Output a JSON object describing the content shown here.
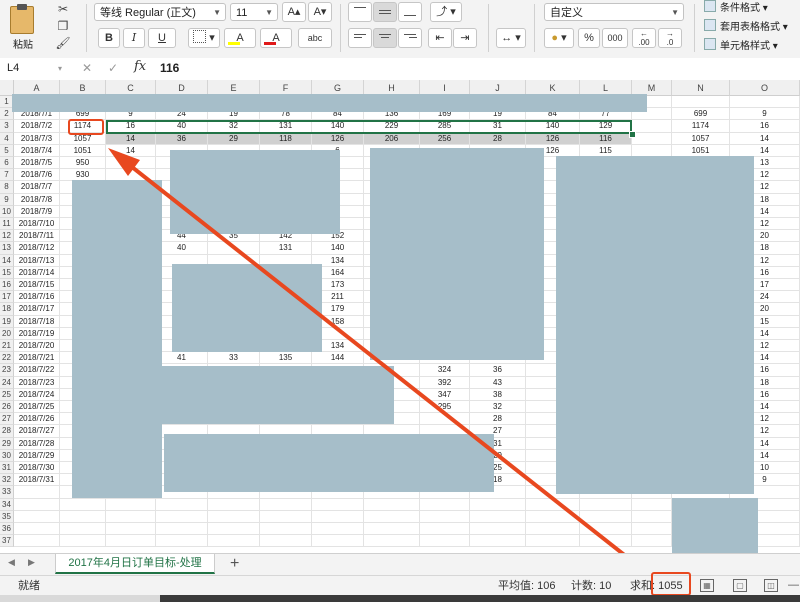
{
  "ribbon": {
    "paste_label": "粘贴",
    "font_name": "等线 Regular (正文)",
    "font_size": "11",
    "grow_font_label": "A▴",
    "shrink_font_label": "A▾",
    "bold_label": "B",
    "italic_label": "I",
    "underline_label": "U",
    "font_color_label": "A",
    "highlight_label": "A",
    "phonetic_label": "abc",
    "number_format": "自定义",
    "percent_label": "%",
    "comma_label": "000",
    "inc_decimal_label": ".00",
    "dec_decimal_label": ".0",
    "conditional_format": "条件格式",
    "format_as_table": "套用表格格式",
    "cell_styles": "单元格样式"
  },
  "formula_bar": {
    "cell_ref": "L4",
    "cancel": "✕",
    "confirm": "✓",
    "fx": "fx",
    "value": "116"
  },
  "columns": [
    "A",
    "B",
    "C",
    "D",
    "E",
    "F",
    "G",
    "H",
    "I",
    "J",
    "K",
    "L",
    "M",
    "N",
    "O"
  ],
  "rows": [
    {
      "n": "1",
      "cells": [
        "",
        "",
        "",
        "",
        "",
        "",
        "",
        "",
        "",
        "",
        "",
        "",
        "",
        "",
        ""
      ]
    },
    {
      "n": "2",
      "cells": [
        "2018/7/1",
        "699",
        "9",
        "24",
        "19",
        "78",
        "84",
        "136",
        "169",
        "19",
        "84",
        "77",
        "",
        "699",
        "9"
      ]
    },
    {
      "n": "3",
      "cells": [
        "2018/7/2",
        "1174",
        "16",
        "40",
        "32",
        "131",
        "140",
        "229",
        "285",
        "31",
        "140",
        "129",
        "",
        "1174",
        "16"
      ]
    },
    {
      "n": "4",
      "cells": [
        "2018/7/3",
        "1057",
        "14",
        "36",
        "29",
        "118",
        "126",
        "206",
        "256",
        "28",
        "126",
        "116",
        "",
        "1057",
        "14"
      ]
    },
    {
      "n": "5",
      "cells": [
        "2018/7/4",
        "1051",
        "14",
        "",
        "",
        "",
        "6",
        "",
        "",
        "",
        "126",
        "115",
        "",
        "1051",
        "14"
      ]
    },
    {
      "n": "6",
      "cells": [
        "2018/7/5",
        "950",
        "",
        "",
        "",
        "",
        "",
        "",
        "",
        "",
        "",
        "",
        "",
        "",
        "13"
      ]
    },
    {
      "n": "7",
      "cells": [
        "2018/7/6",
        "930",
        "",
        "",
        "",
        "",
        "1",
        "",
        "",
        "",
        "",
        "",
        "",
        "",
        "12"
      ]
    },
    {
      "n": "8",
      "cells": [
        "2018/7/7",
        "",
        "",
        "",
        "",
        "",
        "1",
        "",
        "",
        "",
        "",
        "",
        "",
        "",
        "12"
      ]
    },
    {
      "n": "9",
      "cells": [
        "2018/7/8",
        "",
        "",
        "",
        "",
        "",
        "5",
        "",
        "",
        "",
        "",
        "",
        "",
        "",
        "18"
      ]
    },
    {
      "n": "10",
      "cells": [
        "2018/7/9",
        "",
        "",
        "",
        "",
        "",
        "2",
        "",
        "",
        "",
        "",
        "",
        "",
        "",
        "14"
      ]
    },
    {
      "n": "11",
      "cells": [
        "2018/7/10",
        "",
        "",
        "",
        "",
        "",
        "",
        "",
        "",
        "",
        "",
        "",
        "",
        "",
        "12"
      ]
    },
    {
      "n": "12",
      "cells": [
        "2018/7/11",
        "",
        "",
        "44",
        "35",
        "142",
        "152",
        "",
        "",
        "",
        "",
        "",
        "",
        "",
        "20"
      ]
    },
    {
      "n": "13",
      "cells": [
        "2018/7/12",
        "",
        "",
        "40",
        "",
        "131",
        "140",
        "",
        "",
        "",
        "",
        "",
        "",
        "",
        "18"
      ]
    },
    {
      "n": "14",
      "cells": [
        "2018/7/13",
        "",
        "",
        "",
        "",
        "",
        "134",
        "",
        "",
        "",
        "",
        "",
        "",
        "",
        "12"
      ]
    },
    {
      "n": "15",
      "cells": [
        "2018/7/14",
        "",
        "",
        "",
        "",
        "",
        "164",
        "",
        "",
        "",
        "",
        "",
        "",
        "",
        "16"
      ]
    },
    {
      "n": "16",
      "cells": [
        "2018/7/15",
        "",
        "",
        "",
        "",
        "",
        "173",
        "",
        "",
        "",
        "",
        "",
        "",
        "",
        "17"
      ]
    },
    {
      "n": "17",
      "cells": [
        "2018/7/16",
        "",
        "",
        "",
        "",
        "",
        "211",
        "",
        "",
        "",
        "",
        "",
        "",
        "",
        "24"
      ]
    },
    {
      "n": "18",
      "cells": [
        "2018/7/17",
        "",
        "",
        "",
        "",
        "",
        "179",
        "",
        "",
        "",
        "",
        "",
        "",
        "",
        "20"
      ]
    },
    {
      "n": "19",
      "cells": [
        "2018/7/18",
        "",
        "",
        "",
        "",
        "",
        "158",
        "",
        "",
        "",
        "",
        "",
        "",
        "",
        "15"
      ]
    },
    {
      "n": "20",
      "cells": [
        "2018/7/19",
        "",
        "",
        "",
        "",
        "",
        "",
        "",
        "",
        "",
        "",
        "",
        "",
        "",
        "14"
      ]
    },
    {
      "n": "21",
      "cells": [
        "2018/7/20",
        "",
        "",
        "",
        "",
        "",
        "134",
        "",
        "",
        "",
        "",
        "",
        "",
        "",
        "12"
      ]
    },
    {
      "n": "22",
      "cells": [
        "2018/7/21",
        "",
        "",
        "41",
        "33",
        "135",
        "144",
        "235",
        "292",
        "32",
        "",
        "",
        "",
        "",
        "14"
      ]
    },
    {
      "n": "23",
      "cells": [
        "2018/7/22",
        "",
        "",
        "",
        "",
        "",
        "",
        "",
        "324",
        "36",
        "",
        "",
        "",
        "",
        "16"
      ]
    },
    {
      "n": "24",
      "cells": [
        "2018/7/23",
        "",
        "",
        "",
        "",
        "",
        "",
        "",
        "392",
        "43",
        "",
        "",
        "",
        "",
        "18"
      ]
    },
    {
      "n": "25",
      "cells": [
        "2018/7/24",
        "",
        "",
        "",
        "",
        "",
        "",
        "",
        "347",
        "38",
        "",
        "",
        "",
        "",
        "16"
      ]
    },
    {
      "n": "26",
      "cells": [
        "2018/7/25",
        "",
        "",
        "",
        "",
        "",
        "",
        "",
        "295",
        "32",
        "",
        "",
        "",
        "",
        "14"
      ]
    },
    {
      "n": "27",
      "cells": [
        "2018/7/26",
        "",
        "",
        "",
        "",
        "",
        "",
        "",
        "",
        "28",
        "",
        "",
        "",
        "",
        "12"
      ]
    },
    {
      "n": "28",
      "cells": [
        "2018/7/27",
        "",
        "",
        "",
        "",
        "",
        "",
        "",
        "",
        "27",
        "",
        "",
        "",
        "",
        "12"
      ]
    },
    {
      "n": "29",
      "cells": [
        "2018/7/28",
        "",
        "",
        "",
        "",
        "",
        "",
        "",
        "",
        "31",
        "",
        "",
        "",
        "",
        "14"
      ]
    },
    {
      "n": "30",
      "cells": [
        "2018/7/29",
        "",
        "",
        "",
        "",
        "",
        "",
        "",
        "",
        "29",
        "",
        "",
        "",
        "",
        "14"
      ]
    },
    {
      "n": "31",
      "cells": [
        "2018/7/30",
        "",
        "",
        "",
        "",
        "",
        "",
        "",
        "",
        "25",
        "",
        "",
        "",
        "",
        "10"
      ]
    },
    {
      "n": "32",
      "cells": [
        "2018/7/31",
        "",
        "",
        "",
        "",
        "",
        "",
        "",
        "",
        "18",
        "",
        "",
        "",
        "",
        "9"
      ]
    },
    {
      "n": "33",
      "cells": [
        "",
        "",
        "",
        "",
        "",
        "",
        "",
        "",
        "",
        "",
        "",
        "",
        "",
        "",
        ""
      ]
    },
    {
      "n": "34",
      "cells": [
        "",
        "",
        "",
        "",
        "",
        "",
        "",
        "",
        "",
        "",
        "",
        "",
        "",
        "",
        ""
      ]
    },
    {
      "n": "35",
      "cells": [
        "",
        "",
        "",
        "",
        "",
        "",
        "",
        "",
        "",
        "",
        "",
        "",
        "",
        "",
        ""
      ]
    },
    {
      "n": "36",
      "cells": [
        "",
        "",
        "",
        "",
        "",
        "",
        "",
        "",
        "",
        "",
        "",
        "",
        "",
        "",
        ""
      ]
    },
    {
      "n": "37",
      "cells": [
        "",
        "",
        "",
        "",
        "",
        "",
        "",
        "",
        "",
        "",
        "",
        "",
        "",
        "",
        ""
      ]
    }
  ],
  "sheet_tab": "2017年4月日订单目标-处理",
  "add_sheet": "+",
  "status": {
    "ready": "就绪",
    "average": "平均值: 106",
    "count": "计数: 10",
    "sum": "求和: 1055"
  },
  "colors": {
    "accent": "#217346",
    "annotation": "#e8481f",
    "redaction": "#a6bec9"
  }
}
